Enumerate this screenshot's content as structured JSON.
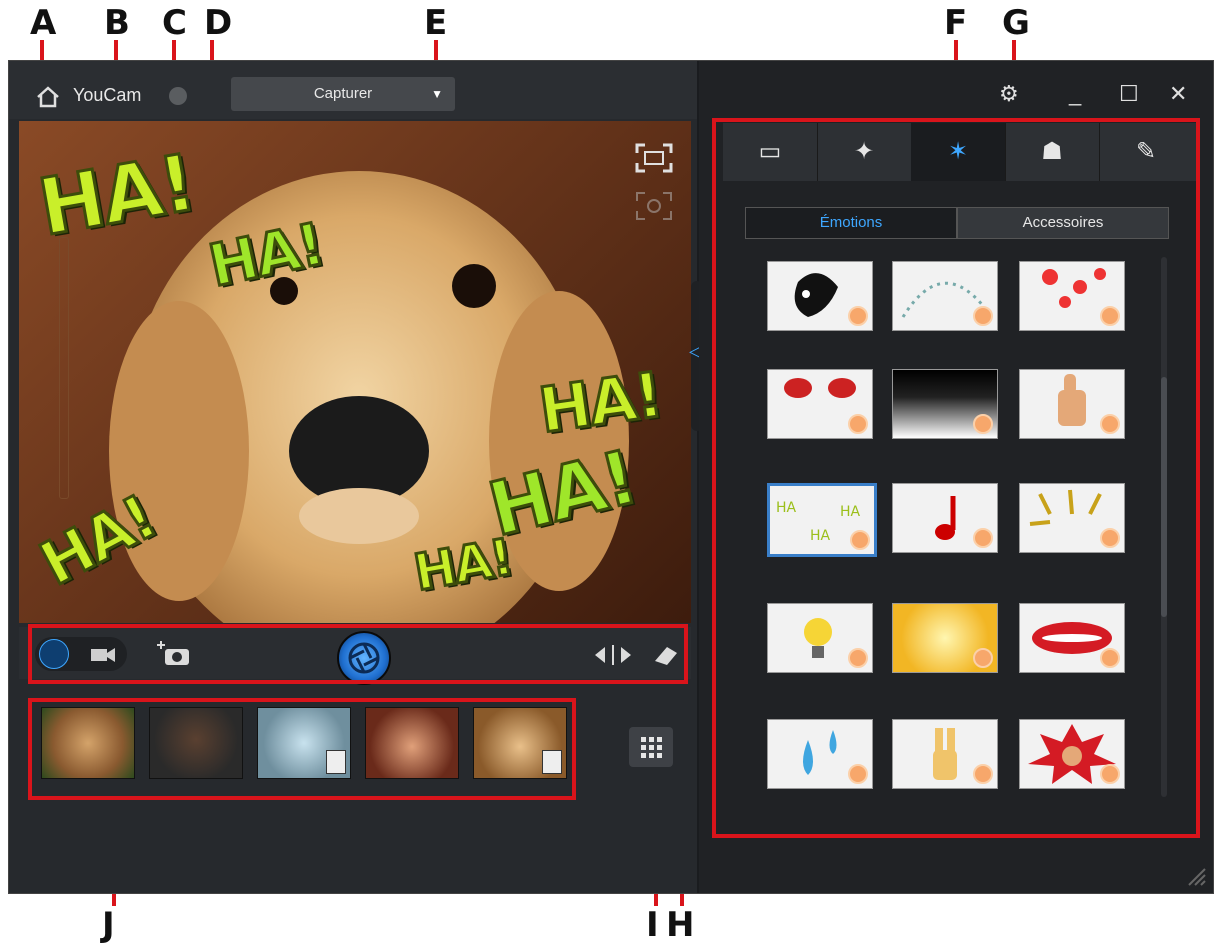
{
  "callouts": {
    "a": "A",
    "b": "B",
    "c": "C",
    "d": "D",
    "e": "E",
    "f": "F",
    "g": "G",
    "h": "H",
    "i": "I",
    "j": "J"
  },
  "app": {
    "name": "YouCam"
  },
  "mode_selector": {
    "value": "Capturer"
  },
  "preview": {
    "ha_text": "HA!"
  },
  "effects": {
    "subtabs": [
      "Émotions",
      "Accessoires"
    ],
    "active_subtab": "Émotions"
  },
  "colors": {
    "accent": "#3ea7ff",
    "callout_red": "#d9141b",
    "overlay_text": "#c9ef2a"
  }
}
